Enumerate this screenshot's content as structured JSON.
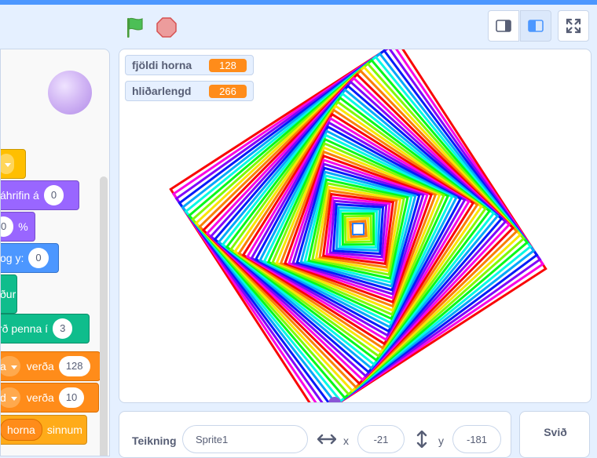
{
  "monitors": [
    {
      "name": "fjöldi horna",
      "value": "128"
    },
    {
      "name": "hliðarlengd",
      "value": "266"
    }
  ],
  "blocks": {
    "effect_label": "áhrifin á",
    "effect_value": "0",
    "size_value": "0",
    "size_unit": "%",
    "goto_label": "og y:",
    "goto_value": "0",
    "teal1_label": "ður",
    "pen_size_label": "rð penna í",
    "pen_size_value": "3",
    "set_var1_dd": "a",
    "set_var1_label": "verða",
    "set_var1_value": "128",
    "set_var2_dd": "d",
    "set_var2_label": "verða",
    "set_var2_value": "10",
    "repeat_var": "horna",
    "repeat_label": "sinnum"
  },
  "sprite_info": {
    "sprite_label": "Teikning",
    "sprite_name": "Sprite1",
    "x_label": "x",
    "x_value": "-21",
    "y_label": "y",
    "y_value": "-181"
  },
  "stage_pane": {
    "label": "Svið"
  },
  "colors": {
    "accent": "#4c97ff",
    "monitor_value": "#ff8c1a"
  },
  "icons": [
    "green-flag-icon",
    "stop-icon",
    "small-stage-icon",
    "normal-stage-icon",
    "fullscreen-icon",
    "move-horizontal-icon",
    "move-vertical-icon"
  ]
}
